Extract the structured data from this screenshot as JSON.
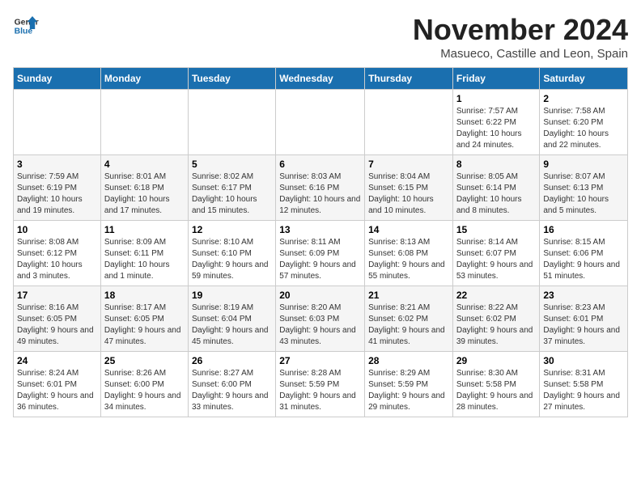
{
  "header": {
    "logo_line1": "General",
    "logo_line2": "Blue",
    "title": "November 2024",
    "subtitle": "Masueco, Castille and Leon, Spain"
  },
  "weekdays": [
    "Sunday",
    "Monday",
    "Tuesday",
    "Wednesday",
    "Thursday",
    "Friday",
    "Saturday"
  ],
  "weeks": [
    [
      {
        "day": "",
        "info": ""
      },
      {
        "day": "",
        "info": ""
      },
      {
        "day": "",
        "info": ""
      },
      {
        "day": "",
        "info": ""
      },
      {
        "day": "",
        "info": ""
      },
      {
        "day": "1",
        "info": "Sunrise: 7:57 AM\nSunset: 6:22 PM\nDaylight: 10 hours and 24 minutes."
      },
      {
        "day": "2",
        "info": "Sunrise: 7:58 AM\nSunset: 6:20 PM\nDaylight: 10 hours and 22 minutes."
      }
    ],
    [
      {
        "day": "3",
        "info": "Sunrise: 7:59 AM\nSunset: 6:19 PM\nDaylight: 10 hours and 19 minutes."
      },
      {
        "day": "4",
        "info": "Sunrise: 8:01 AM\nSunset: 6:18 PM\nDaylight: 10 hours and 17 minutes."
      },
      {
        "day": "5",
        "info": "Sunrise: 8:02 AM\nSunset: 6:17 PM\nDaylight: 10 hours and 15 minutes."
      },
      {
        "day": "6",
        "info": "Sunrise: 8:03 AM\nSunset: 6:16 PM\nDaylight: 10 hours and 12 minutes."
      },
      {
        "day": "7",
        "info": "Sunrise: 8:04 AM\nSunset: 6:15 PM\nDaylight: 10 hours and 10 minutes."
      },
      {
        "day": "8",
        "info": "Sunrise: 8:05 AM\nSunset: 6:14 PM\nDaylight: 10 hours and 8 minutes."
      },
      {
        "day": "9",
        "info": "Sunrise: 8:07 AM\nSunset: 6:13 PM\nDaylight: 10 hours and 5 minutes."
      }
    ],
    [
      {
        "day": "10",
        "info": "Sunrise: 8:08 AM\nSunset: 6:12 PM\nDaylight: 10 hours and 3 minutes."
      },
      {
        "day": "11",
        "info": "Sunrise: 8:09 AM\nSunset: 6:11 PM\nDaylight: 10 hours and 1 minute."
      },
      {
        "day": "12",
        "info": "Sunrise: 8:10 AM\nSunset: 6:10 PM\nDaylight: 9 hours and 59 minutes."
      },
      {
        "day": "13",
        "info": "Sunrise: 8:11 AM\nSunset: 6:09 PM\nDaylight: 9 hours and 57 minutes."
      },
      {
        "day": "14",
        "info": "Sunrise: 8:13 AM\nSunset: 6:08 PM\nDaylight: 9 hours and 55 minutes."
      },
      {
        "day": "15",
        "info": "Sunrise: 8:14 AM\nSunset: 6:07 PM\nDaylight: 9 hours and 53 minutes."
      },
      {
        "day": "16",
        "info": "Sunrise: 8:15 AM\nSunset: 6:06 PM\nDaylight: 9 hours and 51 minutes."
      }
    ],
    [
      {
        "day": "17",
        "info": "Sunrise: 8:16 AM\nSunset: 6:05 PM\nDaylight: 9 hours and 49 minutes."
      },
      {
        "day": "18",
        "info": "Sunrise: 8:17 AM\nSunset: 6:05 PM\nDaylight: 9 hours and 47 minutes."
      },
      {
        "day": "19",
        "info": "Sunrise: 8:19 AM\nSunset: 6:04 PM\nDaylight: 9 hours and 45 minutes."
      },
      {
        "day": "20",
        "info": "Sunrise: 8:20 AM\nSunset: 6:03 PM\nDaylight: 9 hours and 43 minutes."
      },
      {
        "day": "21",
        "info": "Sunrise: 8:21 AM\nSunset: 6:02 PM\nDaylight: 9 hours and 41 minutes."
      },
      {
        "day": "22",
        "info": "Sunrise: 8:22 AM\nSunset: 6:02 PM\nDaylight: 9 hours and 39 minutes."
      },
      {
        "day": "23",
        "info": "Sunrise: 8:23 AM\nSunset: 6:01 PM\nDaylight: 9 hours and 37 minutes."
      }
    ],
    [
      {
        "day": "24",
        "info": "Sunrise: 8:24 AM\nSunset: 6:01 PM\nDaylight: 9 hours and 36 minutes."
      },
      {
        "day": "25",
        "info": "Sunrise: 8:26 AM\nSunset: 6:00 PM\nDaylight: 9 hours and 34 minutes."
      },
      {
        "day": "26",
        "info": "Sunrise: 8:27 AM\nSunset: 6:00 PM\nDaylight: 9 hours and 33 minutes."
      },
      {
        "day": "27",
        "info": "Sunrise: 8:28 AM\nSunset: 5:59 PM\nDaylight: 9 hours and 31 minutes."
      },
      {
        "day": "28",
        "info": "Sunrise: 8:29 AM\nSunset: 5:59 PM\nDaylight: 9 hours and 29 minutes."
      },
      {
        "day": "29",
        "info": "Sunrise: 8:30 AM\nSunset: 5:58 PM\nDaylight: 9 hours and 28 minutes."
      },
      {
        "day": "30",
        "info": "Sunrise: 8:31 AM\nSunset: 5:58 PM\nDaylight: 9 hours and 27 minutes."
      }
    ]
  ]
}
